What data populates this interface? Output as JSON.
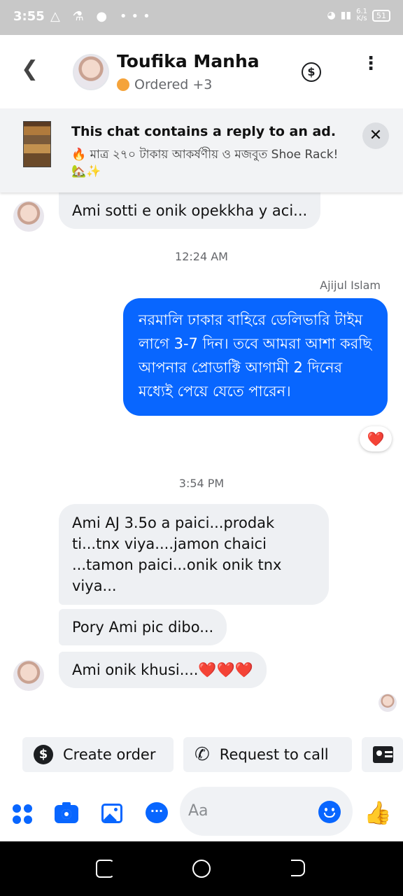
{
  "status_bar": {
    "time": "3:55",
    "notif_icons": "△ ⚗ ● •••",
    "speed_top": "6.1",
    "speed_bottom": "K/s",
    "battery": "51"
  },
  "header": {
    "name": "Toufika Manha",
    "status": "Ordered +3"
  },
  "ad_banner": {
    "title": "This chat contains a reply to an ad.",
    "description": "🔥 মাত্র ২৭০ টাকায় আকর্ষণীয় ও মজবুত Shoe Rack! 🏡✨"
  },
  "messages": {
    "m1": "Ami sotti e onik opekkha y aci...",
    "time1": "12:24 AM",
    "sender": "Ajijul Islam",
    "out1": "নরমালি ঢাকার বাহিরে ডেলিভারি টাইম লাগে 3-7 দিন। তবে আমরা আশা করছি আপনার প্রোডাক্টি আগামী 2 দিনের মধ্যেই পেয়ে যেতে পারেন।",
    "reaction": "❤️",
    "time2": "3:54 PM",
    "m2": "Ami AJ 3.5o a paici...prodak ti...tnx viya....jamon chaici ...tamon paici...onik onik tnx viya...",
    "m3": "Pory Ami pic dibo...",
    "m4": "Ami onik khusi....❤️❤️❤️"
  },
  "quick_actions": {
    "create_order": "Create order",
    "request_call": "Request to call"
  },
  "composer": {
    "placeholder": "Aa"
  },
  "colors": {
    "accent": "#0866ff",
    "incoming_bubble": "#eef0f3",
    "status_dot": "#f5a33a"
  }
}
